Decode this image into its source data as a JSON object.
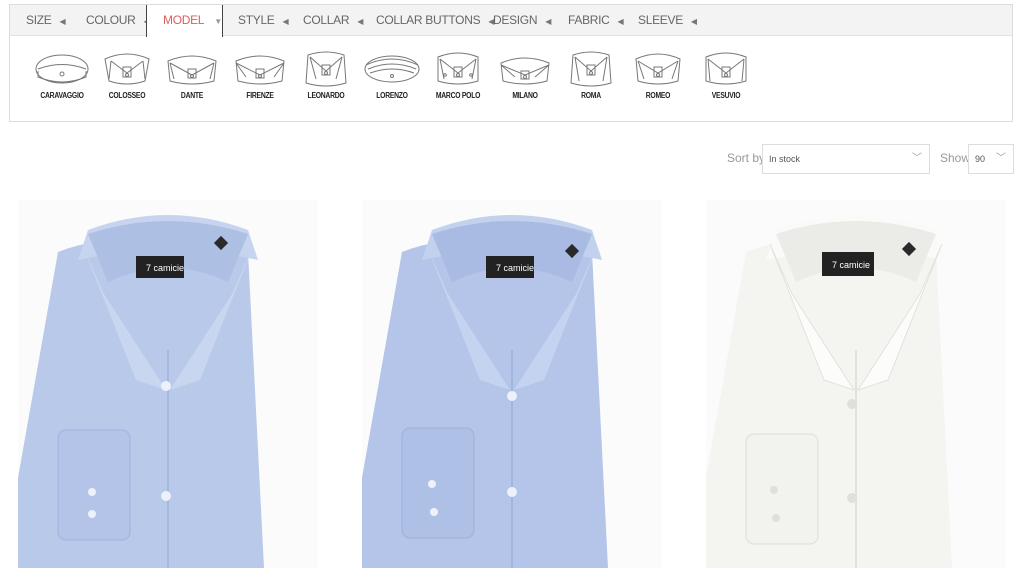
{
  "filters": {
    "tabs": [
      {
        "label": "SIZE"
      },
      {
        "label": "COLOUR"
      },
      {
        "label": "MODEL"
      },
      {
        "label": "STYLE"
      },
      {
        "label": "COLLAR"
      },
      {
        "label": "COLLAR BUTTONS"
      },
      {
        "label": "DESIGN"
      },
      {
        "label": "FABRIC"
      },
      {
        "label": "SLEEVE"
      }
    ],
    "active_color": "#e05a5a",
    "models": [
      {
        "label": "CARAVAGGIO"
      },
      {
        "label": "COLOSSEO"
      },
      {
        "label": "DANTE"
      },
      {
        "label": "FIRENZE"
      },
      {
        "label": "LEONARDO"
      },
      {
        "label": "LORENZO"
      },
      {
        "label": "MARCO POLO"
      },
      {
        "label": "MILANO"
      },
      {
        "label": "ROMA"
      },
      {
        "label": "ROMEO"
      },
      {
        "label": "VESUVIO"
      }
    ]
  },
  "toolbar": {
    "sort_label": "Sort by",
    "sort_value": "In stock",
    "show_label": "Show",
    "show_value": "90"
  },
  "products": [
    {
      "brand": "7 camicie",
      "color": "light-blue",
      "fabric_hex": "#b9c9ea"
    },
    {
      "brand": "7 camicie",
      "color": "light-blue",
      "fabric_hex": "#b4c5e9"
    },
    {
      "brand": "7 camicie",
      "color": "white",
      "fabric_hex": "#f4f4f1"
    }
  ]
}
